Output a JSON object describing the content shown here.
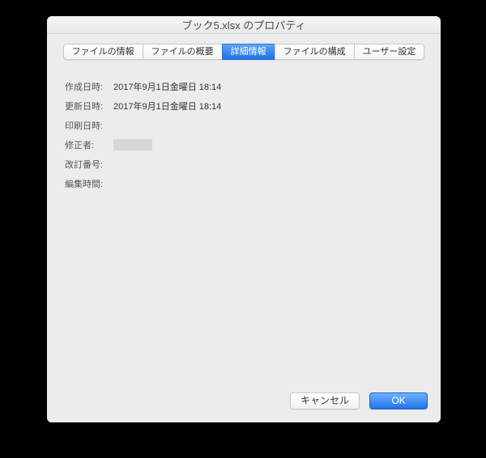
{
  "title": "ブック5.xlsx のプロパティ",
  "tabs": {
    "info": "ファイルの情報",
    "summary": "ファイルの概要",
    "details": "詳細情報",
    "contents": "ファイルの構成",
    "custom": "ユーザー設定"
  },
  "fields": {
    "created": {
      "label": "作成日時:",
      "value": "2017年9月1日金曜日 18:14"
    },
    "modified": {
      "label": "更新日時:",
      "value": "2017年9月1日金曜日 18:14"
    },
    "printed": {
      "label": "印刷日時:",
      "value": ""
    },
    "revisedBy": {
      "label": "修正者:",
      "value": ""
    },
    "revision": {
      "label": "改訂番号:",
      "value": ""
    },
    "editTime": {
      "label": "編集時間:",
      "value": ""
    }
  },
  "footer": {
    "cancel": "キャンセル",
    "ok": "OK"
  }
}
